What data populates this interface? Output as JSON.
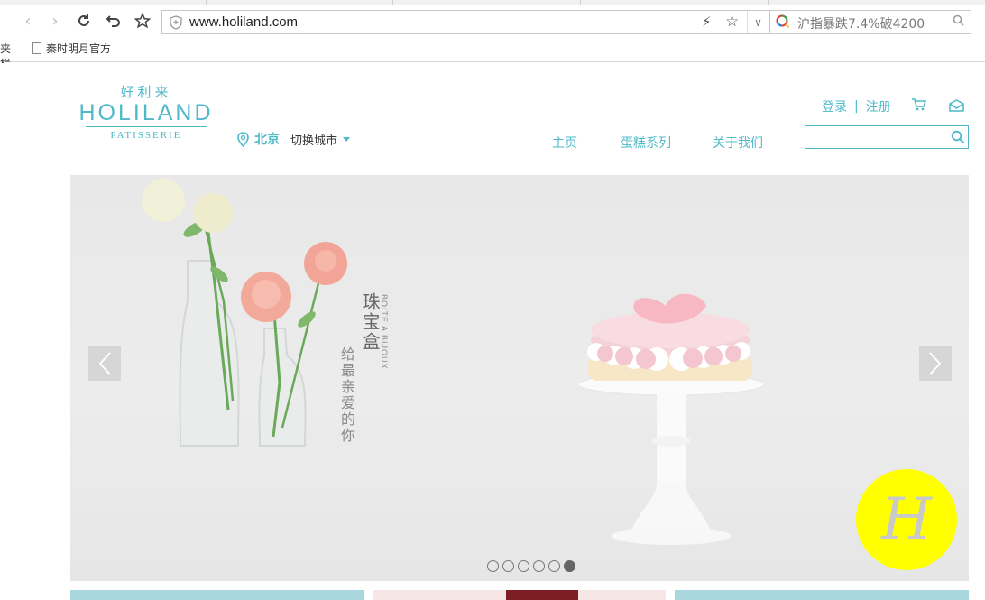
{
  "browser": {
    "url": "www.holiland.com",
    "search_text": "沪指暴跌7.4%破4200",
    "bookmarks": {
      "bar_label": "夹栏",
      "item1": "秦时明月官方"
    }
  },
  "site": {
    "logo": {
      "cn": "好利来",
      "en": "HOLILAND",
      "sub": "PATISSERIE"
    },
    "city": {
      "name": "北京",
      "switch_label": "切换城市"
    },
    "account": {
      "login": "登录",
      "separator": "|",
      "register": "注册"
    },
    "nav": {
      "home": "主页",
      "cakes": "蛋糕系列",
      "about": "关于我们"
    },
    "search": {
      "placeholder": ""
    },
    "banner": {
      "title_cn": "珠宝盒",
      "title_fr": "BOITE A BIJOUX",
      "tagline": "给最亲爱的你",
      "dots_total": 6,
      "active_index": 6
    },
    "badge": {
      "letter": "H"
    }
  },
  "colors": {
    "brand": "#4fb9c9",
    "badge": "#ffff00"
  }
}
